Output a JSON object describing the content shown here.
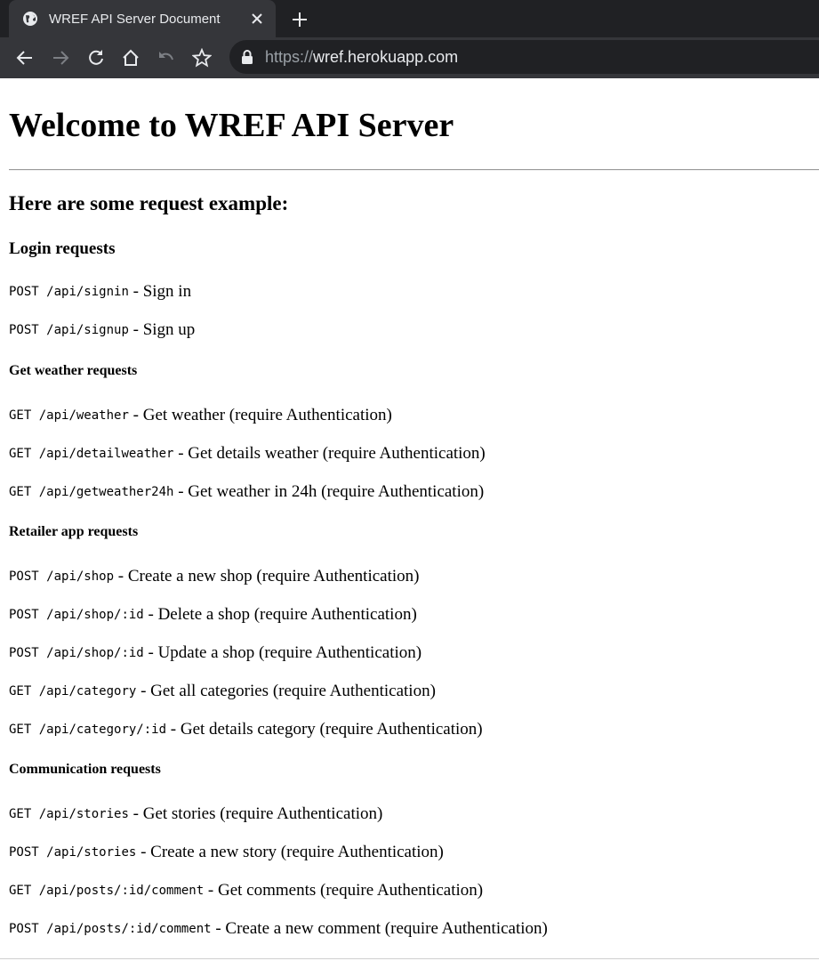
{
  "browser": {
    "tab_title": "WREF API Server Document",
    "url_scheme": "https://",
    "url_host": "wref.herokuapp.com",
    "icons": {
      "tab_favicon": "globe-icon",
      "tab_close": "close-icon",
      "new_tab": "plus-icon",
      "back": "back-arrow-icon",
      "forward": "forward-arrow-icon",
      "reload": "reload-icon",
      "home": "home-icon",
      "undo": "undo-icon",
      "bookmark": "star-icon",
      "secure": "lock-icon"
    },
    "colors": {
      "frame": "#202124",
      "toolbar": "#35363a",
      "text": "#e8eaed"
    }
  },
  "page": {
    "title": "Welcome to WREF API Server",
    "subtitle": "Here are some request example:",
    "sections": [
      {
        "heading": "Login requests",
        "requests": [
          {
            "method": "POST",
            "path": "/api/signin",
            "desc": "Sign in"
          },
          {
            "method": "POST",
            "path": "/api/signup",
            "desc": "Sign up"
          }
        ]
      },
      {
        "heading": "Get weather requests",
        "requests": [
          {
            "method": "GET",
            "path": "/api/weather",
            "desc": "Get weather (require Authentication)"
          },
          {
            "method": "GET",
            "path": "/api/detailweather",
            "desc": "Get details weather (require Authentication)"
          },
          {
            "method": "GET",
            "path": "/api/getweather24h",
            "desc": "Get weather in 24h (require Authentication)"
          }
        ]
      },
      {
        "heading": "Retailer app requests",
        "requests": [
          {
            "method": "POST",
            "path": "/api/shop",
            "desc": "Create a new shop (require Authentication)"
          },
          {
            "method": "POST",
            "path": "/api/shop/:id",
            "desc": "Delete a shop (require Authentication)"
          },
          {
            "method": "POST",
            "path": "/api/shop/:id",
            "desc": "Update a shop (require Authentication)"
          },
          {
            "method": "GET",
            "path": "/api/category",
            "desc": "Get all categories (require Authentication)"
          },
          {
            "method": "GET",
            "path": "/api/category/:id",
            "desc": "Get details category (require Authentication)"
          }
        ]
      },
      {
        "heading": "Communication requests",
        "requests": [
          {
            "method": "GET",
            "path": "/api/stories",
            "desc": "Get stories (require Authentication)"
          },
          {
            "method": "POST",
            "path": "/api/stories",
            "desc": "Create a new story (require Authentication)"
          },
          {
            "method": "GET",
            "path": "/api/posts/:id/comment",
            "desc": "Get comments (require Authentication)"
          },
          {
            "method": "POST",
            "path": "/api/posts/:id/comment",
            "desc": "Create a new comment (require Authentication)"
          }
        ]
      }
    ],
    "separator": " - "
  }
}
